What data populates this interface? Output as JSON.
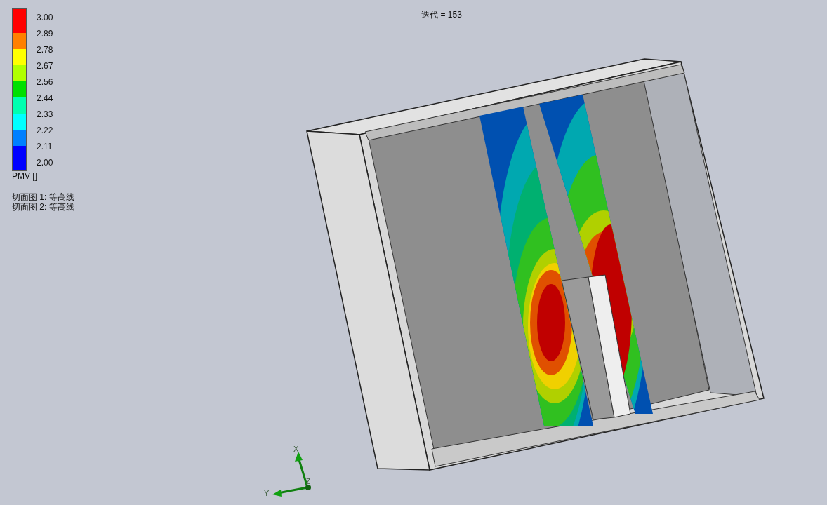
{
  "iteration_label": "迭代 = 153",
  "legend": {
    "bands": [
      {
        "color": "#ff0000"
      },
      {
        "color": "#ff0000"
      },
      {
        "color": "#ff8000"
      },
      {
        "color": "#ffff00"
      },
      {
        "color": "#b0ff00"
      },
      {
        "color": "#00e000"
      },
      {
        "color": "#00ffb0"
      },
      {
        "color": "#00ffff"
      },
      {
        "color": "#0080ff"
      },
      {
        "color": "#0000ff"
      },
      {
        "color": "#0000ff"
      }
    ],
    "ticks": [
      "3.00",
      "2.89",
      "2.78",
      "2.67",
      "2.56",
      "2.44",
      "2.33",
      "2.22",
      "2.11",
      "2.00"
    ],
    "title": "PMV []"
  },
  "captions": [
    "切面图 1: 等高线",
    "切面图 2: 等高线"
  ],
  "axes": [
    "X",
    "Y",
    "Z"
  ]
}
